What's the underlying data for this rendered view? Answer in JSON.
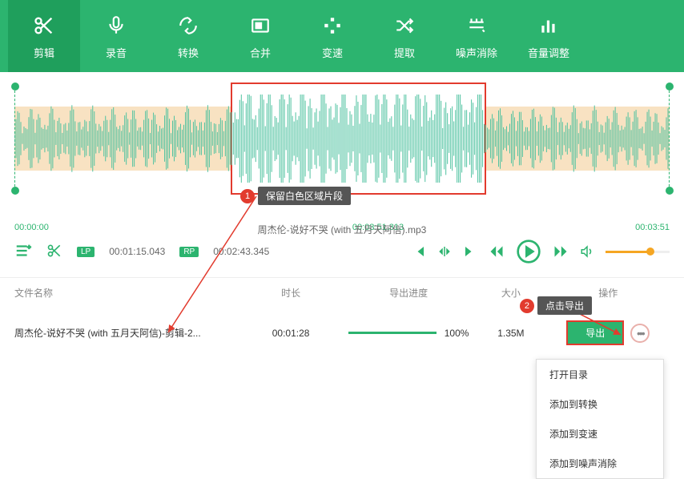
{
  "topbar": {
    "items": [
      {
        "icon": "cut",
        "label": "剪辑"
      },
      {
        "icon": "mic",
        "label": "录音"
      },
      {
        "icon": "convert",
        "label": "转换"
      },
      {
        "icon": "merge",
        "label": "合并"
      },
      {
        "icon": "speed",
        "label": "变速"
      },
      {
        "icon": "extract",
        "label": "提取"
      },
      {
        "icon": "denoise",
        "label": "噪声消除"
      },
      {
        "icon": "volume",
        "label": "音量调整"
      }
    ]
  },
  "annotations": {
    "step1": {
      "num": "1",
      "text": "保留白色区域片段"
    },
    "step2": {
      "num": "2",
      "text": "点击导出"
    }
  },
  "timerow": {
    "start": "00:00:00",
    "mid": "00:03:51.313",
    "end": "00:03:51"
  },
  "current_file": "周杰伦-说好不哭 (with 五月天阿信).mp3",
  "markers": {
    "lp_label": "LP",
    "lp_time": "00:01:15.043",
    "rp_label": "RP",
    "rp_time": "00:02:43.345"
  },
  "table": {
    "headers": {
      "name": "文件名称",
      "duration": "时长",
      "progress": "导出进度",
      "size": "大小",
      "op": "操作"
    },
    "row": {
      "name": "周杰伦-说好不哭 (with 五月天阿信)-剪辑-2...",
      "duration": "00:01:28",
      "progress": "100%",
      "size": "1.35M",
      "export": "导出"
    }
  },
  "dropdown": [
    "打开目录",
    "添加到转换",
    "添加到变速",
    "添加到噪声消除"
  ]
}
